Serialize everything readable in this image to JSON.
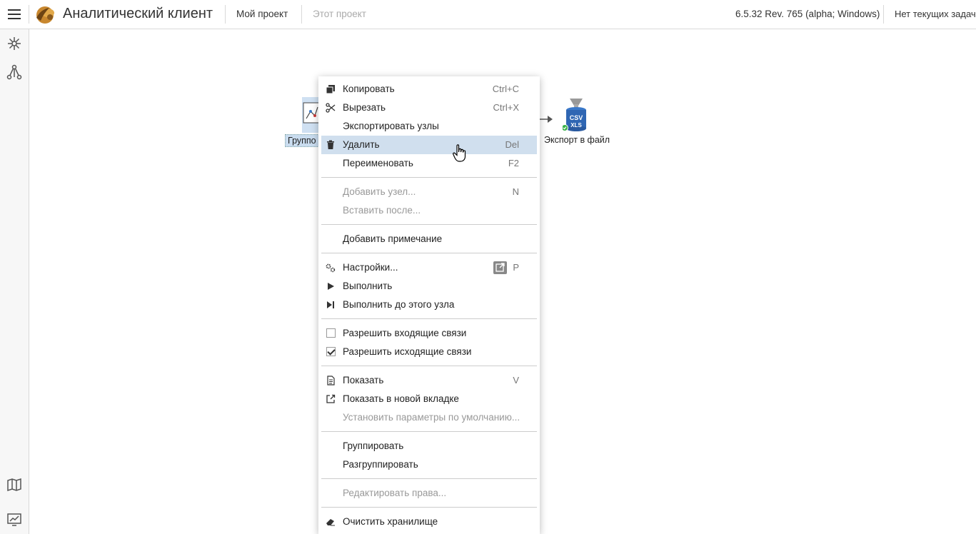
{
  "topbar": {
    "app_title": "Аналитический клиент",
    "project_link": "Мой проект",
    "this_project_link": "Этот проект",
    "version": "6.5.32 Rev. 765 (alpha; Windows)",
    "tasks": "Нет текущих задач"
  },
  "rail": {
    "icons": [
      "nodes-icon",
      "workflow-icon",
      "map-icon",
      "dashboard-icon"
    ]
  },
  "canvas": {
    "node_group_label": "Группо",
    "export_node_label": "Экспорт в файл",
    "export_node_badge": "CSV XLS"
  },
  "menu": {
    "copy": {
      "label": "Копировать",
      "shortcut": "Ctrl+C"
    },
    "cut": {
      "label": "Вырезать",
      "shortcut": "Ctrl+X"
    },
    "export_nodes": {
      "label": "Экспортировать узлы"
    },
    "delete": {
      "label": "Удалить",
      "shortcut": "Del"
    },
    "rename": {
      "label": "Переименовать",
      "shortcut": "F2"
    },
    "add_node": {
      "label": "Добавить узел...",
      "shortcut": "N"
    },
    "insert_after": {
      "label": "Вставить после..."
    },
    "add_note": {
      "label": "Добавить примечание"
    },
    "settings": {
      "label": "Настройки...",
      "shortcut": "P"
    },
    "run": {
      "label": "Выполнить"
    },
    "run_to_node": {
      "label": "Выполнить до этого узла"
    },
    "allow_incoming": {
      "label": "Разрешить входящие связи",
      "checked": false
    },
    "allow_outgoing": {
      "label": "Разрешить исходящие связи",
      "checked": true
    },
    "show": {
      "label": "Показать",
      "shortcut": "V"
    },
    "show_new_tab": {
      "label": "Показать в новой вкладке"
    },
    "set_defaults": {
      "label": "Установить параметры по умолчанию..."
    },
    "group": {
      "label": "Группировать"
    },
    "ungroup": {
      "label": "Разгруппировать"
    },
    "edit_rights": {
      "label": "Редактировать права..."
    },
    "clear_storage": {
      "label": "Очистить хранилище"
    }
  },
  "colors": {
    "highlight": "#d0dfee",
    "selection": "#c9dcef",
    "disabled_text": "#999999"
  }
}
